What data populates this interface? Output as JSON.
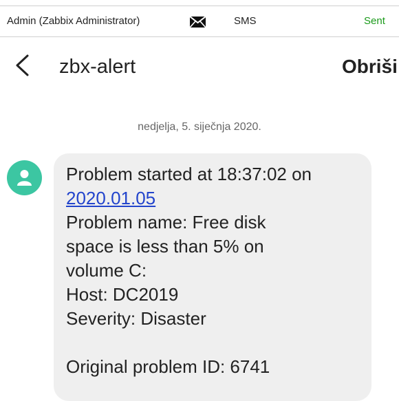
{
  "topbar": {
    "recipient": "Admin (Zabbix Administrator)",
    "envelope_icon": "envelope-icon",
    "media_type": "SMS",
    "status": "Sent",
    "status_color": "#1a9a1a"
  },
  "conversation": {
    "title": "zbx-alert",
    "delete_label": "Obriši"
  },
  "date_separator": "nedjelja, 5. siječnja 2020.",
  "message": {
    "avatar_color": "#3cc6a2",
    "line1": "Problem started at 18:37:02 on",
    "date_link": "2020.01.05",
    "line3": "Problem name: Free disk",
    "line4": "space is less than 5% on",
    "line5": "volume C:",
    "line6": "Host: DC2019",
    "line7": "Severity: Disaster",
    "line8": "Original problem ID: 6741"
  }
}
